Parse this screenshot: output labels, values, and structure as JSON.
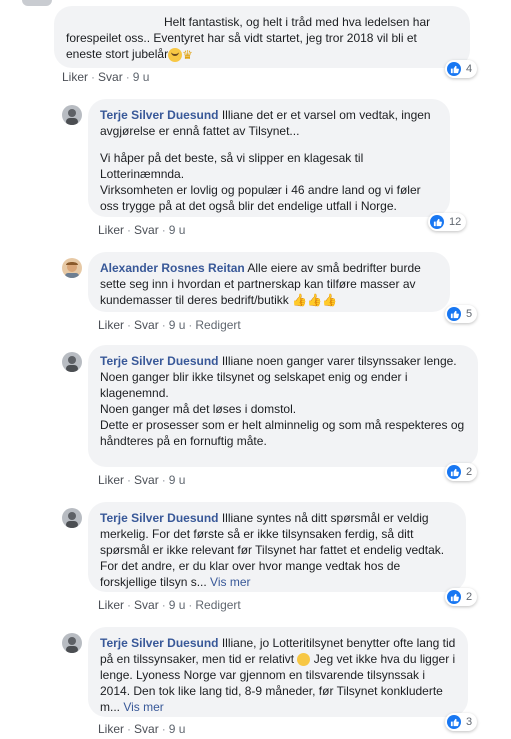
{
  "comments": [
    {
      "text_lines": [
        "Helt fantastisk, og helt i tråd med hva ledelsen har",
        "forespeilet oss.. Eventyret har så vidt startet, jeg tror 2018 vil bli et",
        "eneste stort jubelår"
      ],
      "emojis": [
        "grinning-sweat-emoji",
        "crown-emoji"
      ],
      "actions": {
        "like": "Liker",
        "reply": "Svar",
        "time": "9 u"
      },
      "reactions": {
        "count": "4"
      }
    },
    {
      "author": "Terje Silver Duesund",
      "paragraphs": [
        "Illiane det er et varsel om vedtak, ingen avgjørelse er ennå fattet av Tilsynet...",
        "",
        "Vi håper på det beste, så vi slipper en klagesak til Lotterinæmnda.",
        "Virksomheten er lovlig og populær i 46 andre land og vi føler oss trygge på at det også blir det endelige utfall i Norge."
      ],
      "actions": {
        "like": "Liker",
        "reply": "Svar",
        "time": "9 u"
      },
      "reactions": {
        "count": "12"
      }
    },
    {
      "author": "Alexander Rosnes Reitan",
      "text": "Alle eiere av små bedrifter burde sette seg inn i hvordan et partnerskap kan tilføre masser av kundemasser til deres bedrift/butikk",
      "emojis": [
        "thumbs-up-emoji",
        "thumbs-up-emoji",
        "thumbs-up-emoji"
      ],
      "actions": {
        "like": "Liker",
        "reply": "Svar",
        "time": "9 u",
        "edited": "Redigert"
      },
      "reactions": {
        "count": "5"
      }
    },
    {
      "author": "Terje Silver Duesund",
      "paragraphs": [
        "Illiane noen ganger varer tilsynssaker lenge.",
        "Noen ganger blir ikke tilsynet og selskapet enig og ender i klagenemnd.",
        "Noen ganger må det løses i domstol.",
        "Dette er prosesser som er helt alminnelig og som må respekteres og håndteres på en fornuftig måte."
      ],
      "actions": {
        "like": "Liker",
        "reply": "Svar",
        "time": "9 u"
      },
      "reactions": {
        "count": "2"
      }
    },
    {
      "author": "Terje Silver Duesund",
      "text": "Illiane syntes nå ditt spørsmål er veldig merkelig. For det første så er ikke tilsynsaken ferdig, så ditt spørsmål er ikke relevant før Tilsynet har fattet et endelig vedtak. For det andre, er du klar over hvor mange vedtak hos de forskjellige tilsyn s...",
      "see_more": "Vis mer",
      "actions": {
        "like": "Liker",
        "reply": "Svar",
        "time": "9 u",
        "edited": "Redigert"
      },
      "reactions": {
        "count": "2"
      }
    },
    {
      "author": "Terje Silver Duesund",
      "text_a": "Illiane, jo Lotteritilsynet benytter ofte lang tid på en tilssynsaker, men tid er relativt",
      "text_b": "Jeg vet ikke hva du ligger i lenge. Lyoness Norge var gjennom en tilsvarende tilsynssak i 2014. Den tok like lang tid, 8-9 måneder, før Tilsynet konkluderte m...",
      "emojis": [
        "wink-emoji"
      ],
      "see_more": "Vis mer",
      "actions": {
        "like": "Liker",
        "reply": "Svar",
        "time": "9 u"
      },
      "reactions": {
        "count": "3"
      }
    }
  ],
  "colors": {
    "author": "#385898",
    "bubble": "#f2f3f5",
    "like": "#1877f2",
    "meta": "#606770"
  }
}
